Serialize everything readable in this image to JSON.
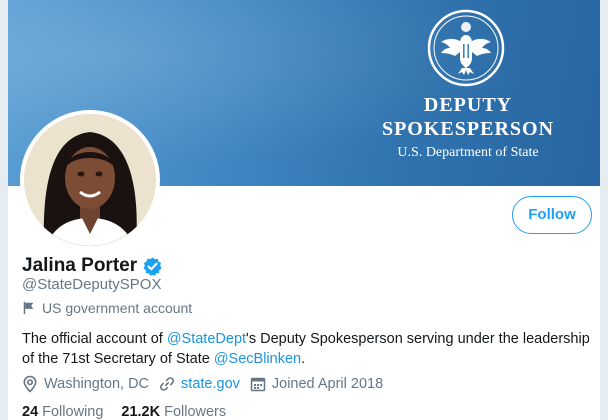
{
  "banner": {
    "title_line1": "DEPUTY",
    "title_line2": "SPOKESPERSON",
    "subtitle": "U.S. Department of State",
    "seal_icon": "great-seal-icon",
    "colors": {
      "gradient_start": "#5a9fd4",
      "gradient_end": "#2766a1"
    }
  },
  "profile": {
    "name": "Jalina Porter",
    "handle": "@StateDeputySPOX",
    "verified": true,
    "label": "US government account",
    "bio": {
      "part1": "The official account of ",
      "mention1": "@StateDept",
      "part2": "'s Deputy Spokesperson serving under the leadership of the 71st Secretary of State ",
      "mention2": "@SecBlinken",
      "part3": "."
    },
    "location": "Washington, DC",
    "website": "state.gov",
    "joined": "Joined April 2018",
    "following_count": "24",
    "following_label": "Following",
    "followers_count": "21.2K",
    "followers_label": "Followers"
  },
  "actions": {
    "follow_label": "Follow"
  },
  "icons": {
    "verified": "verified-badge-icon",
    "flag": "flag-icon",
    "location": "location-pin-icon",
    "link": "link-icon",
    "calendar": "calendar-icon"
  },
  "colors": {
    "accent": "#1da1f2",
    "link": "#1b95e0",
    "muted": "#657786",
    "text": "#14171a"
  }
}
